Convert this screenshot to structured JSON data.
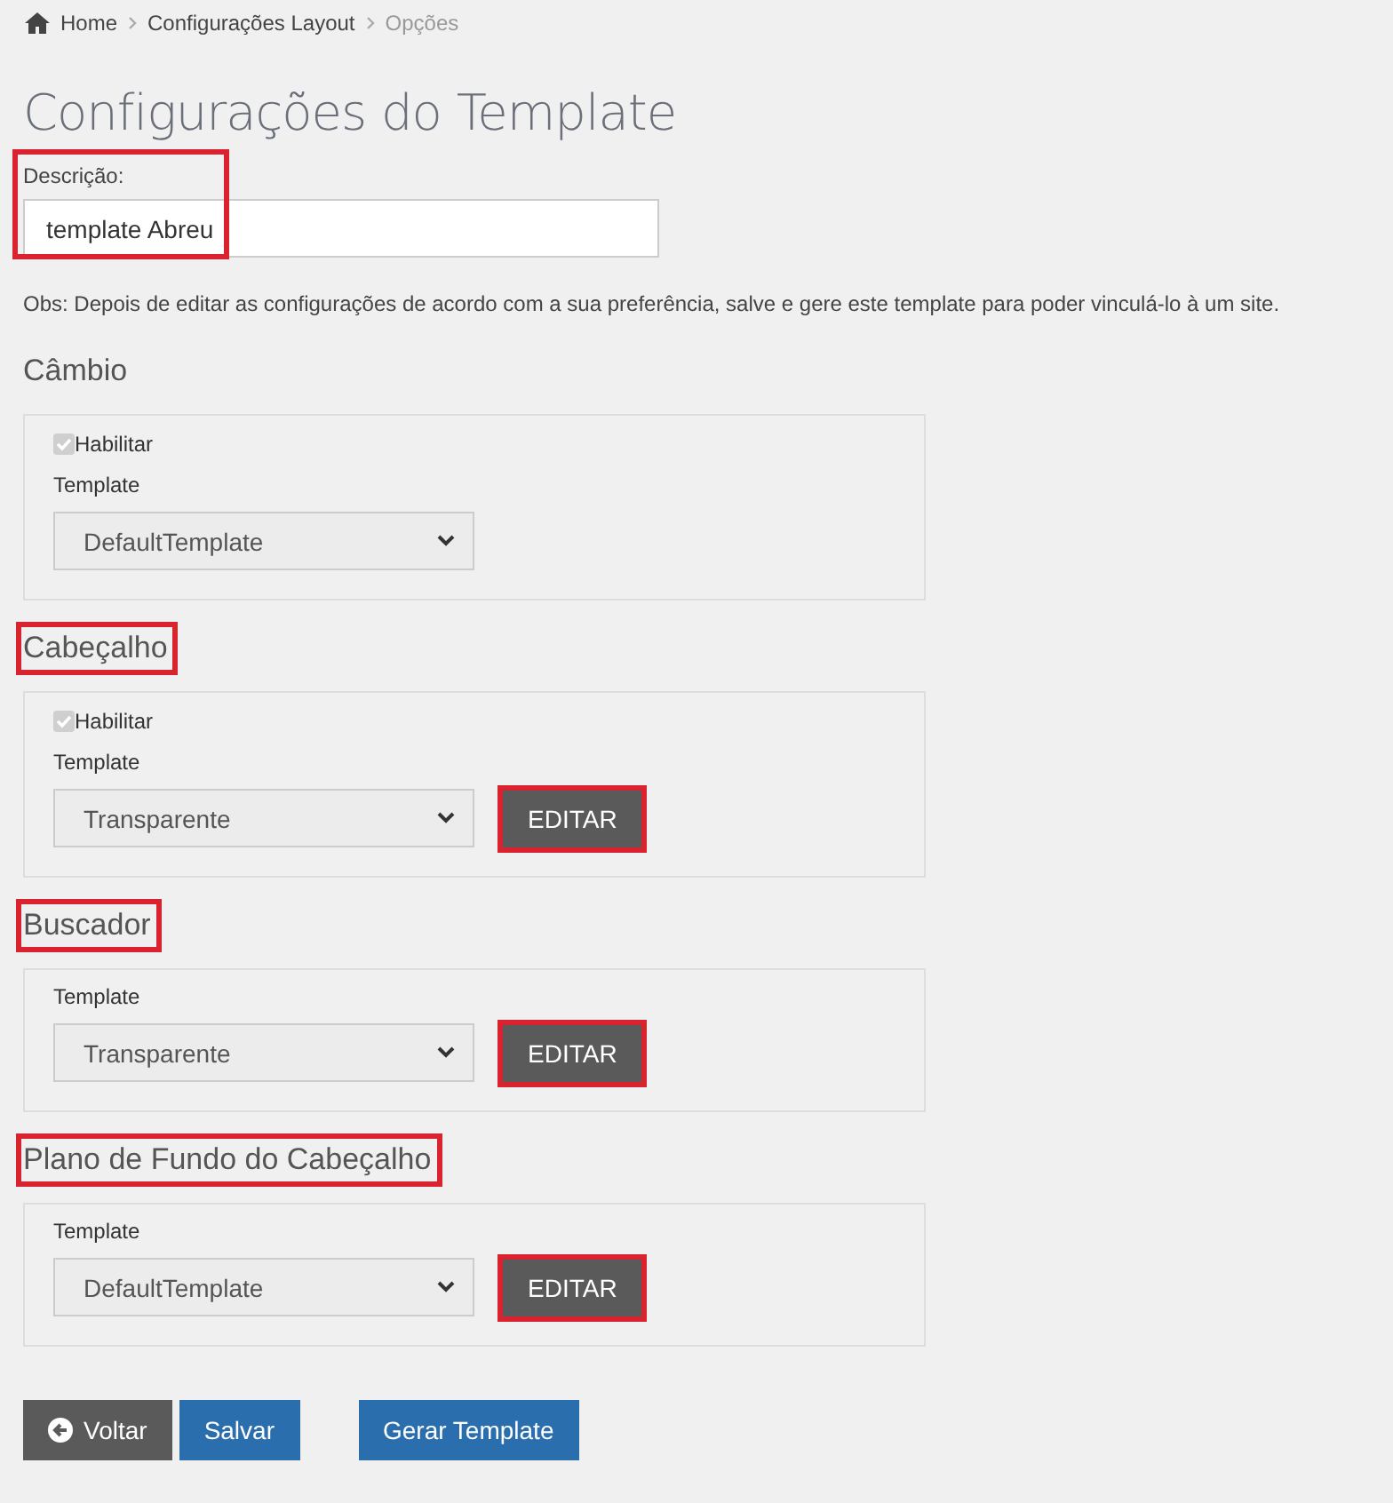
{
  "breadcrumb": [
    {
      "label": "Home",
      "kind": "home"
    },
    {
      "label": "Configurações Layout",
      "kind": "link"
    },
    {
      "label": "Opções",
      "kind": "current"
    }
  ],
  "page_title": "Configurações do Template",
  "description": {
    "label": "Descrição:",
    "value": "template Abreu",
    "highlighted": true
  },
  "note": "Obs: Depois de editar as configurações de acordo com a sua preferência, salve e gere este template para poder vinculá-lo à um site.",
  "sections": [
    {
      "title": "Câmbio",
      "highlighted": false,
      "enable": {
        "label": "Habilitar",
        "checked": true,
        "disabled": true
      },
      "template_label": "Template",
      "template_value": "DefaultTemplate"
    },
    {
      "title": "Cabeçalho",
      "highlighted": true,
      "enable": {
        "label": "Habilitar",
        "checked": true,
        "disabled": true
      },
      "template_label": "Template",
      "template_value": "Transparente",
      "edit_button": {
        "label": "EDITAR",
        "highlighted": true
      }
    },
    {
      "title": "Buscador",
      "highlighted": true,
      "template_label": "Template",
      "template_value": "Transparente",
      "edit_button": {
        "label": "EDITAR",
        "highlighted": true
      }
    },
    {
      "title": "Plano de Fundo do Cabeçalho",
      "highlighted": true,
      "template_label": "Template",
      "template_value": "DefaultTemplate",
      "edit_button": {
        "label": "EDITAR",
        "highlighted": true
      }
    }
  ],
  "actions": [
    {
      "label": "Voltar",
      "kind": "back"
    },
    {
      "label": "Salvar",
      "kind": "primary"
    },
    {
      "label": "Gerar Template",
      "kind": "primary"
    }
  ]
}
